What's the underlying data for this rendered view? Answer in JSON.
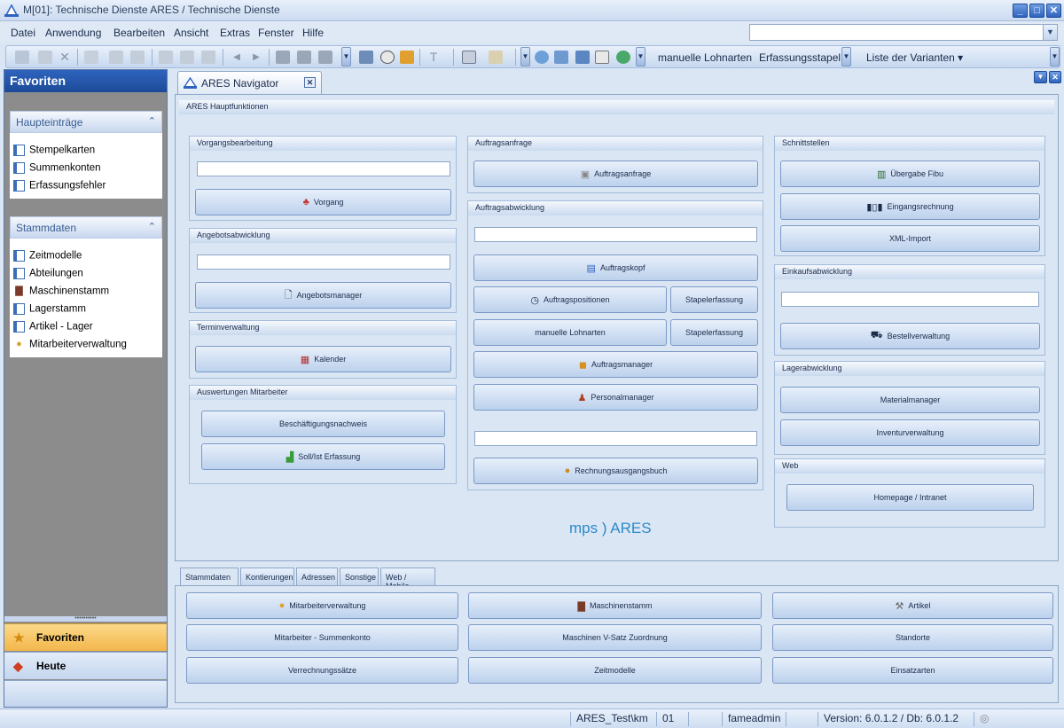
{
  "window": {
    "title": "M[01]: Technische Dienste ARES  / Technische Dienste",
    "minimize": "_",
    "maximize": "□",
    "close": "✕"
  },
  "menu": [
    "Datei",
    "Anwendung",
    "Bearbeiten",
    "Ansicht",
    "Extras",
    "Fenster",
    "Hilfe"
  ],
  "toolbar": {
    "lohnarten": "manuelle Lohnarten",
    "stapel": "Erfassungsstapel",
    "varianten": "Liste der Varianten ▾"
  },
  "sidebar": {
    "header": "Favoriten",
    "groups": [
      {
        "title": "Haupteinträge",
        "items": [
          "Stempelkarten",
          "Summenkonten",
          "Erfassungsfehler"
        ]
      },
      {
        "title": "Stammdaten",
        "items": [
          "Zeitmodelle",
          "Abteilungen",
          "Maschinenstamm",
          "Lagerstamm",
          "Artikel - Lager",
          "Mitarbeiterverwaltung"
        ]
      }
    ],
    "nav": [
      "Favoriten",
      "Heute"
    ]
  },
  "tab": {
    "label": "ARES Navigator"
  },
  "main": {
    "header": "ARES Hauptfunktionen",
    "vorgang": {
      "title": "Vorgangsbearbeitung",
      "button": "Vorgang"
    },
    "angebot": {
      "title": "Angebotsabwicklung",
      "button": "Angebotsmanager"
    },
    "termin": {
      "title": "Terminverwaltung",
      "button": "Kalender"
    },
    "auswertung": {
      "title": "Auswertungen Mitarbeiter",
      "btn1": "Beschäftigungsnachweis",
      "btn2": "Soll/Ist Erfassung"
    },
    "anfrage": {
      "title": "Auftragsanfrage",
      "button": "Auftragsanfrage"
    },
    "auftrag": {
      "title": "Auftragsabwicklung",
      "kopf": "Auftragskopf",
      "positionen": "Auftragspositionen",
      "stapel1": "Stapelerfassung",
      "lohnarten": "manuelle Lohnarten",
      "stapel2": "Stapelerfassung",
      "manager": "Auftragsmanager",
      "personal": "Personalmanager",
      "rechnung": "Rechnungsausgangsbuch"
    },
    "schnitt": {
      "title": "Schnittstellen",
      "fibu": "Übergabe Fibu",
      "eingang": "Eingangsrechnung",
      "xml": "XML-Import"
    },
    "einkauf": {
      "title": "Einkaufsabwicklung",
      "button": "Bestellverwaltung"
    },
    "lager": {
      "title": "Lagerabwicklung",
      "material": "Materialmanager",
      "inventur": "Inventurverwaltung"
    },
    "web": {
      "title": "Web",
      "button": "Homepage / Intranet"
    },
    "logo": "mps )  ARES"
  },
  "bottom": {
    "tabs": [
      "Stammdaten",
      "Kontierungen",
      "Adressen",
      "Sonstige",
      "Web / Mobile"
    ],
    "buttons": [
      "Mitarbeiterverwaltung",
      "Maschinenstamm",
      "Artikel",
      "Mitarbeiter - Summenkonto",
      "Maschinen V-Satz Zuordnung",
      "Standorte",
      "Verrechnungssätze",
      "Zeitmodelle",
      "Einsatzarten"
    ]
  },
  "status": {
    "db": "ARES_Test\\km",
    "mandant": "01",
    "user": "fameadmin",
    "version": "Version: 6.0.1.2 / Db: 6.0.1.2"
  }
}
